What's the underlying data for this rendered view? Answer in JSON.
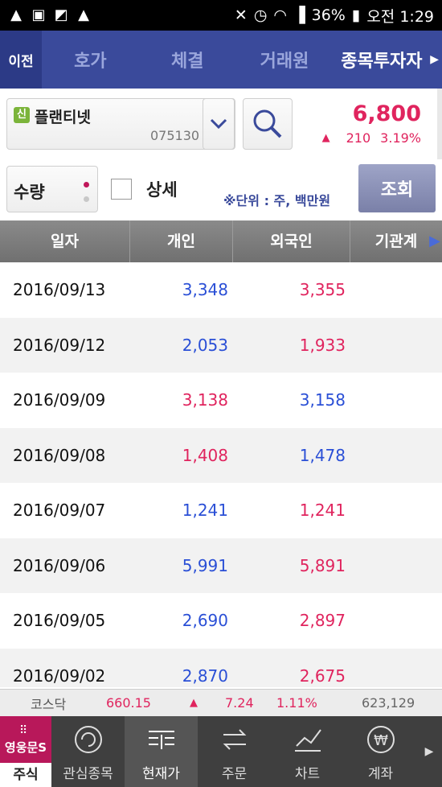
{
  "status_bar": {
    "battery": "36%",
    "time": "오전 1:29"
  },
  "tabs": {
    "prev": "이전",
    "items": [
      {
        "label": "호가"
      },
      {
        "label": "체결"
      },
      {
        "label": "거래원"
      },
      {
        "label": "종목투자자"
      }
    ],
    "active_index": 3
  },
  "stock": {
    "credit_badge": "신",
    "name": "플랜티넷",
    "code": "075130",
    "price": "6,800",
    "change": "210",
    "change_pct": "3.19%",
    "direction": "up"
  },
  "options": {
    "qty_label": "수량",
    "detail_label": "상세",
    "detail_checked": false,
    "unit_note": "※단위 : 주, 백만원",
    "query_button": "조회"
  },
  "table": {
    "headers": {
      "date": "일자",
      "individual": "개인",
      "foreign": "외국인",
      "institution": "기관계"
    },
    "rows": [
      {
        "date": "2016/09/13",
        "individual": "3,348",
        "individual_color": "#2a4fd6",
        "foreign": "3,355",
        "foreign_color": "#e0245e",
        "institution": ""
      },
      {
        "date": "2016/09/12",
        "individual": "2,053",
        "individual_color": "#2a4fd6",
        "foreign": "1,933",
        "foreign_color": "#e0245e",
        "institution": ""
      },
      {
        "date": "2016/09/09",
        "individual": "3,138",
        "individual_color": "#e0245e",
        "foreign": "3,158",
        "foreign_color": "#2a4fd6",
        "institution": ""
      },
      {
        "date": "2016/09/08",
        "individual": "1,408",
        "individual_color": "#e0245e",
        "foreign": "1,478",
        "foreign_color": "#2a4fd6",
        "institution": ""
      },
      {
        "date": "2016/09/07",
        "individual": "1,241",
        "individual_color": "#2a4fd6",
        "foreign": "1,241",
        "foreign_color": "#e0245e",
        "institution": ""
      },
      {
        "date": "2016/09/06",
        "individual": "5,991",
        "individual_color": "#2a4fd6",
        "foreign": "5,891",
        "foreign_color": "#e0245e",
        "institution": ""
      },
      {
        "date": "2016/09/05",
        "individual": "2,690",
        "individual_color": "#2a4fd6",
        "foreign": "2,897",
        "foreign_color": "#e0245e",
        "institution": ""
      },
      {
        "date": "2016/09/02",
        "individual": "2,870",
        "individual_color": "#2a4fd6",
        "foreign": "2,675",
        "foreign_color": "#e0245e",
        "institution": ""
      }
    ]
  },
  "index_bar": {
    "name": "코스닥",
    "value": "660.15",
    "change": "7.24",
    "change_pct": "1.11%",
    "volume": "623,129"
  },
  "bottom_nav": {
    "home_brand": "영웅문S",
    "home_label": "주식",
    "items": [
      {
        "label": "관심종목",
        "icon": "refresh-circle-icon"
      },
      {
        "label": "현재가",
        "icon": "price-chart-icon"
      },
      {
        "label": "주문",
        "icon": "exchange-arrows-icon"
      },
      {
        "label": "차트",
        "icon": "line-chart-icon"
      },
      {
        "label": "계좌",
        "icon": "won-coin-icon"
      }
    ],
    "active_index": 1
  },
  "colors": {
    "accent": "#3a4a9b",
    "up": "#e0245e",
    "down": "#2a4fd6",
    "brand": "#b8185a"
  }
}
